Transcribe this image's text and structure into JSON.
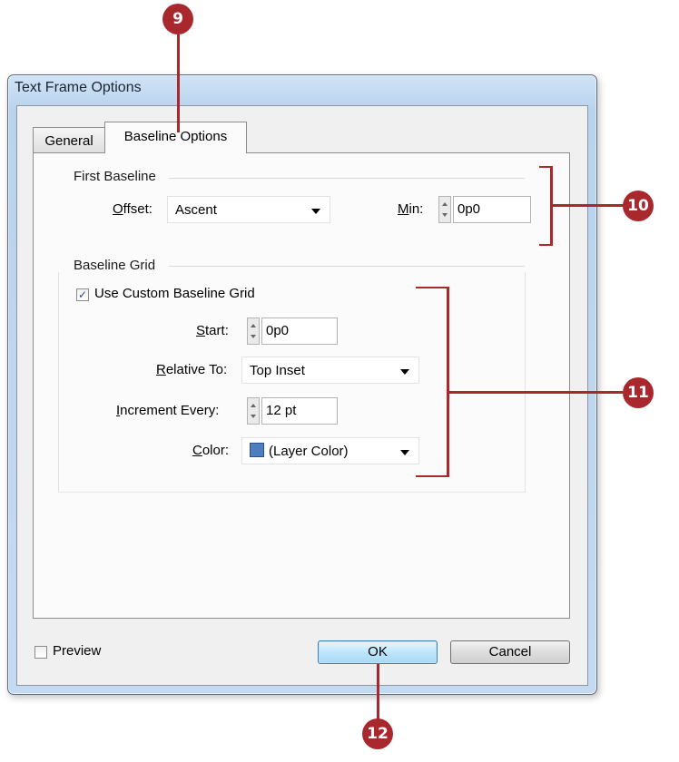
{
  "window": {
    "title": "Text Frame Options"
  },
  "tabs": [
    {
      "label": "General",
      "active": false
    },
    {
      "label": "Baseline Options",
      "active": true
    }
  ],
  "first_baseline": {
    "heading": "First Baseline",
    "offset": {
      "label_u": "O",
      "label_rest": "ffset:",
      "value": "Ascent"
    },
    "min": {
      "label_u": "M",
      "label_rest": "in:",
      "value": "0p0"
    }
  },
  "baseline_grid": {
    "heading": "Baseline Grid",
    "use_custom": {
      "label": "Use Custom Baseline Grid",
      "checked": true
    },
    "start": {
      "label_u": "S",
      "label_rest": "tart:",
      "value": "0p0"
    },
    "relative_to": {
      "label_u": "R",
      "label_rest": "elative To:",
      "value": "Top Inset"
    },
    "increment_every": {
      "label_u": "I",
      "label_rest": "ncrement Every:",
      "value": "12 pt"
    },
    "color": {
      "label_u": "C",
      "label_rest": "olor:",
      "value": "(Layer Color)",
      "swatch": "#4f7fc1"
    }
  },
  "footer": {
    "preview_label": "Preview",
    "preview_checked": false,
    "ok_label": "OK",
    "cancel_label": "Cancel"
  },
  "callouts": [
    "9",
    "10",
    "11",
    "12"
  ],
  "colors": {
    "callout": "#a8282e",
    "default_button": "#bee6fd"
  }
}
